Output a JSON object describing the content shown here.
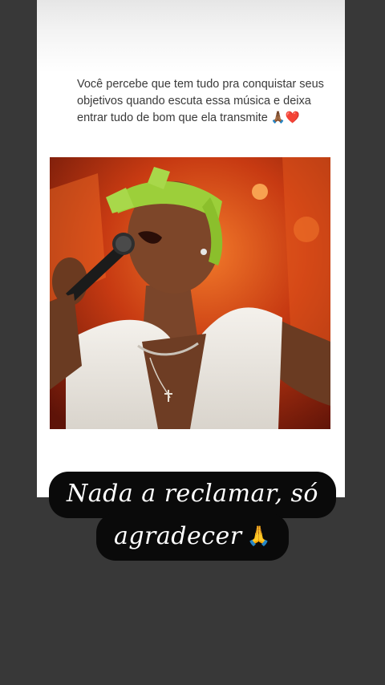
{
  "post": {
    "caption": "Você percebe que tem tudo pra conquistar seus objetivos quando escuta essa música e deixa entrar tudo de bom que ela transmite",
    "caption_emojis": "🙏🏾❤️"
  },
  "sticker": {
    "line1": "Nada a reclamar, só",
    "line2": "agradecer",
    "line2_emoji": "🙏"
  },
  "colors": {
    "background": "#383838",
    "card": "#ffffff",
    "sticker_bg": "#0a0a0a",
    "sticker_text": "#ffffff"
  },
  "icons": {
    "photo": "singer-with-microphone-photo"
  }
}
